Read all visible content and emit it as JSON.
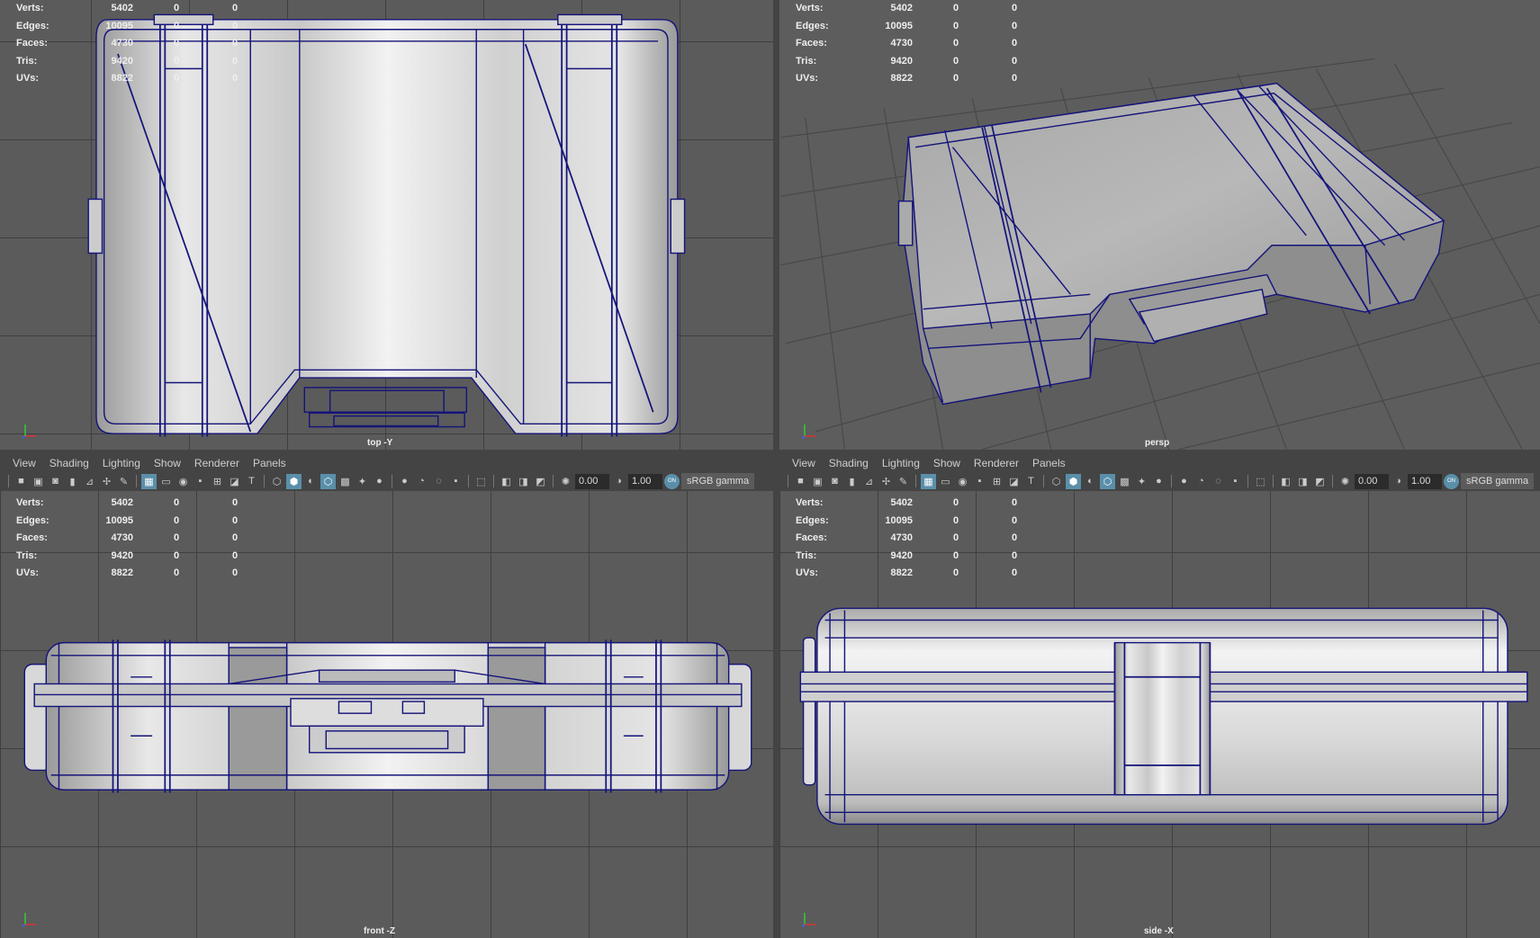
{
  "hud": {
    "rows": [
      {
        "label": "Verts:",
        "value": "5402",
        "a": "0",
        "b": "0"
      },
      {
        "label": "Edges:",
        "value": "10095",
        "a": "0",
        "b": "0"
      },
      {
        "label": "Faces:",
        "value": "4730",
        "a": "0",
        "b": "0"
      },
      {
        "label": "Tris:",
        "value": "9420",
        "a": "0",
        "b": "0"
      },
      {
        "label": "UVs:",
        "value": "8822",
        "a": "0",
        "b": "0"
      }
    ]
  },
  "viewports": {
    "top": "top -Y",
    "persp": "persp",
    "front": "front -Z",
    "side": "side -X"
  },
  "menu": [
    "View",
    "Shading",
    "Lighting",
    "Show",
    "Renderer",
    "Panels"
  ],
  "toolbar": {
    "icons": [
      {
        "name": "select-camera-icon",
        "g": "■",
        "on": false
      },
      {
        "name": "lock-camera-icon",
        "g": "▣",
        "on": false
      },
      {
        "name": "camera-attributes-icon",
        "g": "◙",
        "on": false
      },
      {
        "name": "bookmark-icon",
        "g": "▮",
        "on": false
      },
      {
        "name": "image-plane-icon",
        "g": "⊿",
        "on": false
      },
      {
        "name": "pivot-icon",
        "g": "✢",
        "on": false
      },
      {
        "name": "grease-pencil-icon",
        "g": "✎",
        "on": false
      },
      {
        "sep": true
      },
      {
        "name": "grid-icon",
        "g": "▦",
        "on": true
      },
      {
        "name": "film-gate-icon",
        "g": "▭",
        "on": false
      },
      {
        "name": "resolution-gate-icon",
        "g": "◉",
        "on": false
      },
      {
        "name": "gate-mask-icon",
        "g": "▪",
        "on": false
      },
      {
        "name": "field-chart-icon",
        "g": "⊞",
        "on": false
      },
      {
        "name": "safe-action-icon",
        "g": "◪",
        "on": false
      },
      {
        "name": "safe-title-icon",
        "g": "T",
        "on": false
      },
      {
        "sep": true
      },
      {
        "name": "wireframe-icon",
        "g": "⬡",
        "on": false
      },
      {
        "name": "smooth-shade-icon",
        "g": "⬢",
        "on": true
      },
      {
        "name": "default-material-icon",
        "g": "◐",
        "on": false
      },
      {
        "name": "wireframe-on-shaded-icon",
        "g": "⬡",
        "on": true
      },
      {
        "name": "xray-icon",
        "g": "▩",
        "on": false
      },
      {
        "name": "lights-icon",
        "g": "✦",
        "on": false
      },
      {
        "name": "shadows-icon",
        "g": "●",
        "on": false
      },
      {
        "sep": true
      },
      {
        "name": "screen-space-ao-icon",
        "g": "●",
        "on": false
      },
      {
        "name": "motion-blur-icon",
        "g": "◔",
        "on": false
      },
      {
        "name": "anti-alias-icon",
        "g": "◌",
        "on": false
      },
      {
        "name": "depth-of-field-icon",
        "g": "▪",
        "on": false
      },
      {
        "sep": true
      },
      {
        "name": "isolate-select-icon",
        "g": "⬚",
        "on": false
      },
      {
        "sep": true
      },
      {
        "name": "xray-joints-icon",
        "g": "◧",
        "on": false
      },
      {
        "name": "xray-active-icon",
        "g": "◨",
        "on": false
      },
      {
        "name": "backface-cull-icon",
        "g": "◩",
        "on": false
      },
      {
        "sep": true
      },
      {
        "name": "exposure-icon",
        "g": "✺",
        "on": false
      }
    ],
    "exposure": "0.00",
    "gamma_icon": "gamma-icon",
    "gamma": "1.00",
    "color_mgmt": "ON",
    "view_transform": "sRGB gamma"
  },
  "colors": {
    "wire": "#14147a",
    "bg": "#5b5b5b",
    "accent": "#5a8faa"
  }
}
